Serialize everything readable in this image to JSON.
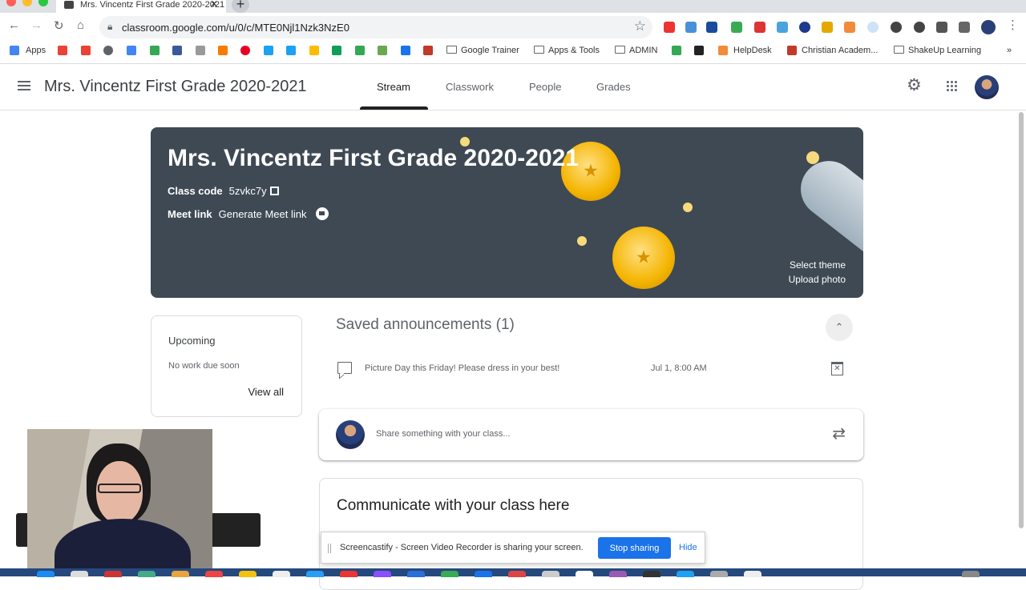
{
  "browser": {
    "tab_title": "Mrs. Vincentz First Grade 2020-2021",
    "tab_close": "✕",
    "new_tab": "+",
    "url": "classroom.google.com/u/0/c/MTE0Njl1Nzk3NzE0",
    "bookmarks": [
      "Apps",
      "Google Trainer",
      "Apps & Tools",
      "ADMIN",
      "HelpDesk",
      "Christian Academ...",
      "ShakeUp Learning"
    ],
    "bookmarks_more": "»"
  },
  "header": {
    "title": "Mrs. Vincentz First Grade 2020-2021",
    "tabs": [
      "Stream",
      "Classwork",
      "People",
      "Grades"
    ],
    "active_tab": "Stream"
  },
  "banner": {
    "title": "Mrs. Vincentz First Grade 2020-2021",
    "class_code_label": "Class code",
    "class_code": "5zvkc7y",
    "meet_label": "Meet link",
    "meet_action": "Generate Meet link",
    "select_theme": "Select theme",
    "upload_photo": "Upload photo"
  },
  "upcoming": {
    "title": "Upcoming",
    "empty": "No work due soon",
    "view_all": "View all"
  },
  "saved": {
    "title": "Saved announcements (1)",
    "items": [
      {
        "text": "Picture Day this Friday! Please dress in your best!",
        "date": "Jul 1, 8:00 AM"
      }
    ]
  },
  "share": {
    "placeholder": "Share something with your class..."
  },
  "communicate": {
    "title": "Communicate with your class here"
  },
  "screencastify": {
    "message": "Screencastify - Screen Video Recorder is sharing your screen.",
    "stop": "Stop sharing",
    "hide": "Hide"
  },
  "colors": {
    "banner_bg": "#3e4954",
    "accent_blue": "#1a73e8",
    "medal_gold": "#f4b400"
  }
}
